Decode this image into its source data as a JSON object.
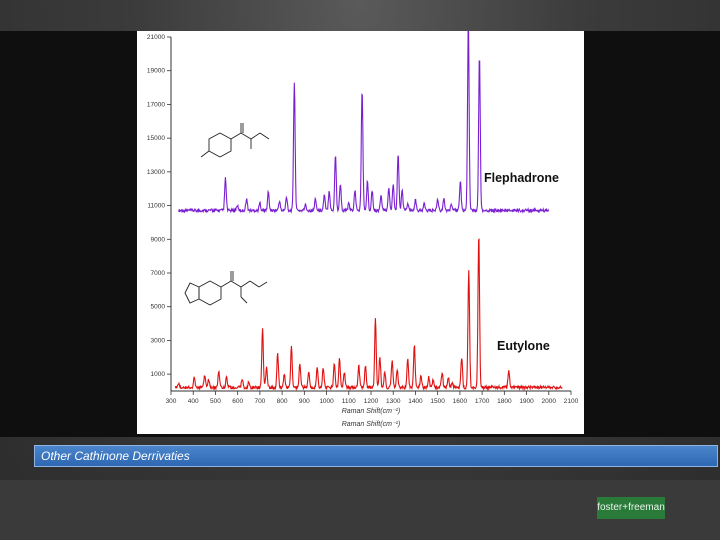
{
  "slide": {
    "caption": "Other Cathinone Derrivaties",
    "logo_text": "foster+freeman"
  },
  "colors": {
    "flephadrone": "#7a1fd0",
    "eutylone": "#e01010",
    "caption_bar": "#3a72bd"
  },
  "chart_data": {
    "type": "line",
    "xlabel": "Raman Shift(cm⁻¹)",
    "xlabel_secondary": "Raman Shift(cm⁻¹)",
    "xlim": [
      300,
      2100
    ],
    "x_ticks": [
      "300",
      "400",
      "500",
      "600",
      "700",
      "800",
      "900",
      "1000",
      "1100",
      "1200",
      "1300",
      "1400",
      "1500",
      "1600",
      "1700",
      "1800",
      "1900",
      "2000",
      "2100"
    ],
    "ylim": [
      0,
      21000
    ],
    "y_ticks": [
      "1000",
      "3000",
      "5000",
      "7000",
      "9000",
      "11000",
      "13000",
      "15000",
      "17000",
      "19000",
      "21000"
    ],
    "grid": false,
    "series": [
      {
        "name": "Flephadrone",
        "offset": 10500,
        "peaks": [
          [
            545,
            1900
          ],
          [
            598,
            300
          ],
          [
            640,
            700
          ],
          [
            700,
            450
          ],
          [
            738,
            1100
          ],
          [
            788,
            550
          ],
          [
            820,
            800
          ],
          [
            855,
            7600
          ],
          [
            905,
            350
          ],
          [
            950,
            700
          ],
          [
            990,
            900
          ],
          [
            1012,
            1200
          ],
          [
            1040,
            3300
          ],
          [
            1062,
            1600
          ],
          [
            1100,
            400
          ],
          [
            1128,
            1200
          ],
          [
            1160,
            7200
          ],
          [
            1184,
            1700
          ],
          [
            1205,
            1200
          ],
          [
            1245,
            900
          ],
          [
            1280,
            1400
          ],
          [
            1300,
            1600
          ],
          [
            1322,
            3300
          ],
          [
            1340,
            1200
          ],
          [
            1365,
            400
          ],
          [
            1400,
            600
          ],
          [
            1440,
            400
          ],
          [
            1500,
            700
          ],
          [
            1528,
            650
          ],
          [
            1562,
            350
          ],
          [
            1602,
            1800
          ],
          [
            1638,
            11200
          ],
          [
            1688,
            9200
          ]
        ]
      },
      {
        "name": "Eutylone",
        "offset": 0,
        "peaks": [
          [
            335,
            200
          ],
          [
            405,
            600
          ],
          [
            452,
            750
          ],
          [
            470,
            500
          ],
          [
            515,
            1000
          ],
          [
            550,
            600
          ],
          [
            620,
            500
          ],
          [
            650,
            300
          ],
          [
            712,
            3500
          ],
          [
            730,
            1200
          ],
          [
            780,
            2000
          ],
          [
            810,
            800
          ],
          [
            842,
            2400
          ],
          [
            880,
            1400
          ],
          [
            920,
            900
          ],
          [
            958,
            1200
          ],
          [
            985,
            1200
          ],
          [
            1035,
            1400
          ],
          [
            1058,
            1700
          ],
          [
            1080,
            900
          ],
          [
            1145,
            1300
          ],
          [
            1175,
            1300
          ],
          [
            1220,
            4100
          ],
          [
            1240,
            1800
          ],
          [
            1262,
            900
          ],
          [
            1295,
            1600
          ],
          [
            1318,
            1100
          ],
          [
            1365,
            1700
          ],
          [
            1395,
            2500
          ],
          [
            1425,
            700
          ],
          [
            1460,
            600
          ],
          [
            1480,
            500
          ],
          [
            1520,
            900
          ],
          [
            1548,
            600
          ],
          [
            1565,
            300
          ],
          [
            1608,
            1800
          ],
          [
            1640,
            7000
          ],
          [
            1685,
            9200
          ],
          [
            1820,
            1000
          ]
        ]
      }
    ],
    "annotations": [
      {
        "text": "Flephadrone",
        "series": "Flephadrone"
      },
      {
        "text": "Eutylone",
        "series": "Eutylone"
      }
    ]
  }
}
